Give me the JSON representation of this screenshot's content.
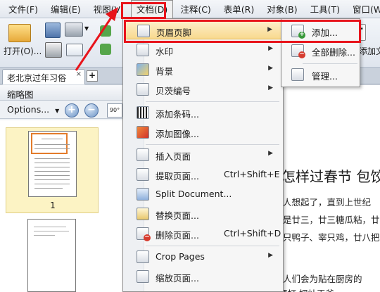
{
  "menubar": [
    "文件(F)",
    "编辑(E)",
    "视图(V)",
    "文档(D)",
    "注释(C)",
    "表单(R)",
    "对象(B)",
    "工具(T)",
    "窗口(W)"
  ],
  "toolbar": {
    "open_label": "打开(O)...",
    "partial_label": "添加文",
    "text_tool_letter": "T"
  },
  "tabs": {
    "active_tab": "老北京过年习俗",
    "close": "×",
    "add": "+"
  },
  "panel": {
    "title": "缩略图",
    "options_label": "Options...",
    "zoom_in": "+",
    "zoom_out": "−",
    "rotate_label": "90°",
    "page_number": "1"
  },
  "document": {
    "title": "怎样过春节 包饺",
    "lines": [
      "人想起了，直到上世纪",
      "是廿三，廿三糖瓜粘，廿",
      "只鸭子、宰只鸡，廿八把",
      "人们会为贴在厨房的",
      "拜打 把灶王爷"
    ]
  },
  "menu": {
    "items": [
      {
        "label": "页眉页脚",
        "shortcut": "",
        "submenu": true,
        "icon": "header-footer-icon"
      },
      {
        "label": "水印",
        "shortcut": "",
        "submenu": true,
        "icon": "watermark-icon"
      },
      {
        "label": "背景",
        "shortcut": "",
        "submenu": true,
        "icon": "background-icon"
      },
      {
        "label": "贝茨编号",
        "shortcut": "",
        "submenu": true,
        "icon": "bates-number-icon"
      },
      {
        "label": "添加条码...",
        "shortcut": "",
        "submenu": false,
        "icon": "barcode-icon"
      },
      {
        "label": "添加图像...",
        "shortcut": "",
        "submenu": false,
        "icon": "image-icon"
      },
      {
        "label": "插入页面",
        "shortcut": "",
        "submenu": true,
        "icon": "insert-page-icon"
      },
      {
        "label": "提取页面...",
        "shortcut": "Ctrl+Shift+E",
        "submenu": false,
        "icon": "extract-page-icon"
      },
      {
        "label": "Split Document...",
        "shortcut": "",
        "submenu": false,
        "icon": "split-document-icon"
      },
      {
        "label": "替换页面...",
        "shortcut": "",
        "submenu": false,
        "icon": "replace-page-icon"
      },
      {
        "label": "删除页面...",
        "shortcut": "Ctrl+Shift+D",
        "submenu": false,
        "icon": "delete-page-icon"
      },
      {
        "label": "Crop Pages",
        "shortcut": "",
        "submenu": true,
        "icon": "crop-pages-icon"
      },
      {
        "label": "缩放页面...",
        "shortcut": "",
        "submenu": false,
        "icon": "resize-page-icon"
      }
    ]
  },
  "submenu": {
    "items": [
      {
        "label": "添加...",
        "icon": "add-header-footer-icon"
      },
      {
        "label": "全部删除...",
        "icon": "remove-all-header-footer-icon"
      },
      {
        "label": "管理...",
        "icon": "manage-header-footer-icon"
      }
    ]
  },
  "colors": {
    "highlight": "#f8d98e",
    "annotation_red": "#e8141b",
    "selection_orange": "#e37c2b"
  }
}
